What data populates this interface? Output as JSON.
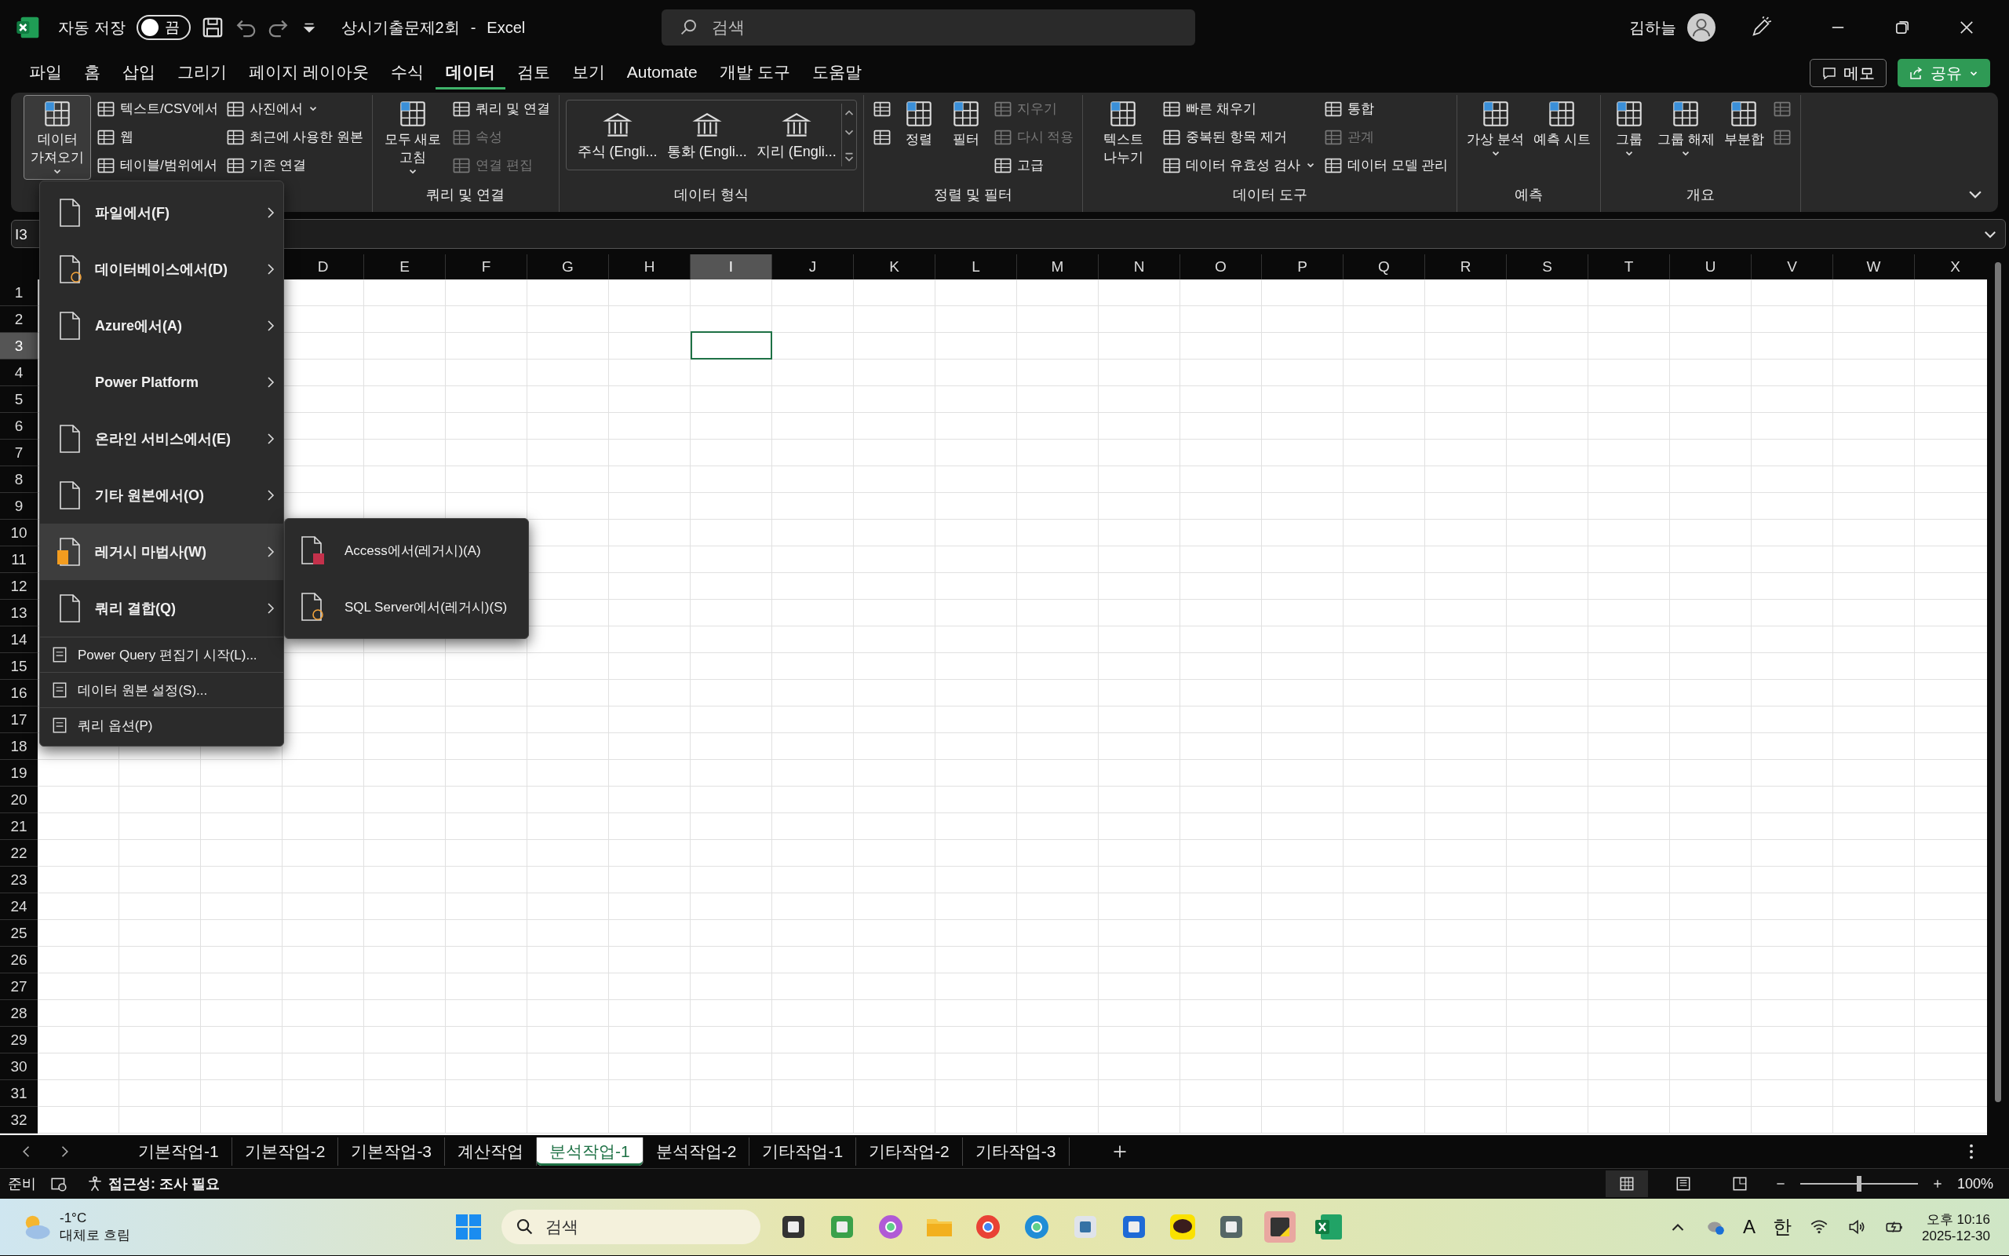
{
  "title_bar": {
    "autosave_label": "자동 저장",
    "autosave": {
      "on": false,
      "label": "끔"
    },
    "document": "상시기출문제2회",
    "separator": "-",
    "app": "Excel",
    "search": {
      "placeholder": "검색"
    },
    "user": "김하늘"
  },
  "menu_tabs": [
    {
      "label": "파일",
      "selected": false
    },
    {
      "label": "홈",
      "selected": false
    },
    {
      "label": "삽입",
      "selected": false
    },
    {
      "label": "그리기",
      "selected": false
    },
    {
      "label": "페이지 레이아웃",
      "selected": false
    },
    {
      "label": "수식",
      "selected": false
    },
    {
      "label": "데이터",
      "selected": true
    },
    {
      "label": "검토",
      "selected": false
    },
    {
      "label": "보기",
      "selected": false
    },
    {
      "label": "Automate",
      "selected": false
    },
    {
      "label": "개발 도구",
      "selected": false
    },
    {
      "label": "도움말",
      "selected": false
    }
  ],
  "menu_actions": {
    "comments": "메모",
    "share": "공유"
  },
  "ribbon": {
    "groups": [
      {
        "controls": [
          {
            "kind": "large",
            "label": "데이터 가져오기",
            "dropdown": true,
            "pressed": true,
            "disabled": false
          },
          {
            "kind": "stack",
            "items": [
              {
                "label": "텍스트/CSV에서",
                "dropdown": false,
                "disabled": false
              },
              {
                "label": "웹",
                "dropdown": false,
                "disabled": false
              },
              {
                "label": "테이블/범위에서",
                "dropdown": false,
                "disabled": false
              }
            ]
          },
          {
            "kind": "stack",
            "items": [
              {
                "label": "사진에서",
                "dropdown": true,
                "disabled": false
              },
              {
                "label": "최근에 사용한 원본",
                "dropdown": false,
                "disabled": false
              },
              {
                "label": "기존 연결",
                "dropdown": false,
                "disabled": false
              }
            ]
          }
        ]
      },
      {
        "label": "쿼리 및 연결",
        "controls": [
          {
            "kind": "large",
            "label": "모두 새로 고침",
            "dropdown": true,
            "pressed": false,
            "disabled": false
          },
          {
            "kind": "stack",
            "items": [
              {
                "label": "쿼리 및 연결",
                "dropdown": false,
                "disabled": false
              },
              {
                "label": "속성",
                "dropdown": false,
                "disabled": true
              },
              {
                "label": "연결 편집",
                "dropdown": false,
                "disabled": true
              }
            ]
          }
        ]
      },
      {
        "label": "데이터 형식",
        "controls": [
          {
            "kind": "gallery",
            "items": [
              {
                "label": "주식 (Engli..."
              },
              {
                "label": "통화 (Engli..."
              },
              {
                "label": "지리 (Engli..."
              }
            ]
          }
        ]
      },
      {
        "label": "정렬 및 필터",
        "controls": [
          {
            "kind": "stack",
            "items": [
              {
                "dropdown": false,
                "disabled": false
              },
              {
                "dropdown": false,
                "disabled": false
              }
            ]
          },
          {
            "kind": "large",
            "label": "정렬",
            "dropdown": false,
            "pressed": false,
            "disabled": false
          },
          {
            "kind": "large",
            "label": "필터",
            "dropdown": false,
            "pressed": false,
            "disabled": false
          },
          {
            "kind": "stack",
            "items": [
              {
                "label": "지우기",
                "dropdown": false,
                "disabled": true
              },
              {
                "label": "다시 적용",
                "dropdown": false,
                "disabled": true
              },
              {
                "label": "고급",
                "dropdown": false,
                "disabled": false
              }
            ]
          }
        ]
      },
      {
        "label": "데이터 도구",
        "controls": [
          {
            "kind": "large",
            "label": "텍스트 나누기",
            "dropdown": false,
            "pressed": false,
            "disabled": false
          },
          {
            "kind": "stack",
            "items": [
              {
                "label": "빠른 채우기",
                "dropdown": false,
                "disabled": false
              },
              {
                "label": "중복된 항목 제거",
                "dropdown": false,
                "disabled": false
              },
              {
                "label": "데이터 유효성 검사",
                "dropdown": true,
                "disabled": false
              }
            ]
          },
          {
            "kind": "stack",
            "items": [
              {
                "label": "통합",
                "dropdown": false,
                "disabled": false
              },
              {
                "label": "관계",
                "dropdown": false,
                "disabled": true
              },
              {
                "label": "데이터 모델 관리",
                "dropdown": false,
                "disabled": false
              }
            ]
          }
        ]
      },
      {
        "label": "예측",
        "controls": [
          {
            "kind": "large",
            "label": "가상 분석",
            "dropdown": true,
            "pressed": false,
            "disabled": false
          },
          {
            "kind": "large",
            "label": "예측 시트",
            "dropdown": false,
            "pressed": false,
            "disabled": false
          }
        ]
      },
      {
        "label": "개요",
        "controls": [
          {
            "kind": "large",
            "label": "그룹",
            "dropdown": true,
            "pressed": false,
            "disabled": false
          },
          {
            "kind": "large",
            "label": "그룹 해제",
            "dropdown": true,
            "pressed": false,
            "disabled": false
          },
          {
            "kind": "large",
            "label": "부분합",
            "dropdown": false,
            "pressed": false,
            "disabled": false
          },
          {
            "kind": "stack",
            "items": [
              {
                "dropdown": false,
                "disabled": true
              },
              {
                "dropdown": false,
                "disabled": true
              }
            ]
          }
        ]
      }
    ]
  },
  "name_box": "I3",
  "columns": [
    {
      "label": "D",
      "selected": false
    },
    {
      "label": "E",
      "selected": false
    },
    {
      "label": "F",
      "selected": false
    },
    {
      "label": "G",
      "selected": false
    },
    {
      "label": "H",
      "selected": false
    },
    {
      "label": "I",
      "selected": true
    },
    {
      "label": "J",
      "selected": false
    },
    {
      "label": "K",
      "selected": false
    },
    {
      "label": "L",
      "selected": false
    },
    {
      "label": "M",
      "selected": false
    },
    {
      "label": "N",
      "selected": false
    },
    {
      "label": "O",
      "selected": false
    },
    {
      "label": "P",
      "selected": false
    },
    {
      "label": "Q",
      "selected": false
    },
    {
      "label": "R",
      "selected": false
    },
    {
      "label": "S",
      "selected": false
    },
    {
      "label": "T",
      "selected": false
    },
    {
      "label": "U",
      "selected": false
    },
    {
      "label": "V",
      "selected": false
    },
    {
      "label": "W",
      "selected": false
    },
    {
      "label": "X",
      "selected": false
    }
  ],
  "rows": [
    {
      "label": "1",
      "selected": false
    },
    {
      "label": "2",
      "selected": false
    },
    {
      "label": "3",
      "selected": true
    },
    {
      "label": "4",
      "selected": false
    },
    {
      "label": "5",
      "selected": false
    },
    {
      "label": "6",
      "selected": false
    },
    {
      "label": "7",
      "selected": false
    },
    {
      "label": "8",
      "selected": false
    },
    {
      "label": "9",
      "selected": false
    },
    {
      "label": "10",
      "selected": false
    },
    {
      "label": "11",
      "selected": false
    },
    {
      "label": "12",
      "selected": false
    },
    {
      "label": "13",
      "selected": false
    },
    {
      "label": "14",
      "selected": false
    },
    {
      "label": "15",
      "selected": false
    },
    {
      "label": "16",
      "selected": false
    },
    {
      "label": "17",
      "selected": false
    },
    {
      "label": "18",
      "selected": false
    },
    {
      "label": "19",
      "selected": false
    },
    {
      "label": "20",
      "selected": false
    },
    {
      "label": "21",
      "selected": false
    },
    {
      "label": "22",
      "selected": false
    },
    {
      "label": "23",
      "selected": false
    },
    {
      "label": "24",
      "selected": false
    },
    {
      "label": "25",
      "selected": false
    },
    {
      "label": "26",
      "selected": false
    },
    {
      "label": "27",
      "selected": false
    },
    {
      "label": "28",
      "selected": false
    },
    {
      "label": "29",
      "selected": false
    },
    {
      "label": "30",
      "selected": false
    },
    {
      "label": "31",
      "selected": false
    },
    {
      "label": "32",
      "selected": false
    }
  ],
  "import_menu": {
    "items": [
      {
        "kind": "large",
        "label": "파일에서(F)",
        "submenu": true,
        "selected": false
      },
      {
        "kind": "large",
        "label": "데이터베이스에서(D)",
        "submenu": true,
        "selected": false
      },
      {
        "kind": "large",
        "label": "Azure에서(A)",
        "submenu": true,
        "selected": false
      },
      {
        "kind": "large",
        "label": "Power Platform",
        "submenu": true,
        "selected": false
      },
      {
        "kind": "large",
        "label": "온라인 서비스에서(E)",
        "submenu": true,
        "selected": false
      },
      {
        "kind": "large",
        "label": "기타 원본에서(O)",
        "submenu": true,
        "selected": false
      },
      {
        "kind": "large",
        "label": "레거시 마법사(W)",
        "submenu": true,
        "selected": true
      },
      {
        "kind": "large",
        "label": "쿼리 결합(Q)",
        "submenu": true,
        "selected": false
      },
      {
        "kind": "small",
        "label": "Power Query 편집기 시작(L)...",
        "selected": false
      },
      {
        "kind": "small",
        "label": "데이터 원본 설정(S)...",
        "selected": false
      },
      {
        "kind": "small",
        "label": "쿼리 옵션(P)",
        "selected": false
      }
    ],
    "submenu": [
      {
        "label": "Access에서(레거시)(A)"
      },
      {
        "label": "SQL Server에서(레거시)(S)"
      }
    ]
  },
  "sheet_tabs": [
    {
      "label": "기본작업-1",
      "selected": false
    },
    {
      "label": "기본작업-2",
      "selected": false
    },
    {
      "label": "기본작업-3",
      "selected": false
    },
    {
      "label": "계산작업",
      "selected": false
    },
    {
      "label": "분석작업-1",
      "selected": true
    },
    {
      "label": "분석작업-2",
      "selected": false
    },
    {
      "label": "기타작업-1",
      "selected": false
    },
    {
      "label": "기타작업-2",
      "selected": false
    },
    {
      "label": "기타작업-3",
      "selected": false
    }
  ],
  "status_bar": {
    "mode": "준비",
    "accessibility": "접근성: 조사 필요",
    "views": [
      {
        "selected": true
      },
      {
        "selected": false
      },
      {
        "selected": false
      }
    ],
    "zoom": {
      "level": 0.5,
      "reading": "100%"
    }
  },
  "taskbar": {
    "temperature": "-1°C",
    "weather": "대체로 흐림",
    "search": {
      "placeholder": "검색"
    },
    "ime_letter": "A",
    "ime_lang": "한",
    "time": "오후 10:16",
    "date": "2025-12-30"
  }
}
